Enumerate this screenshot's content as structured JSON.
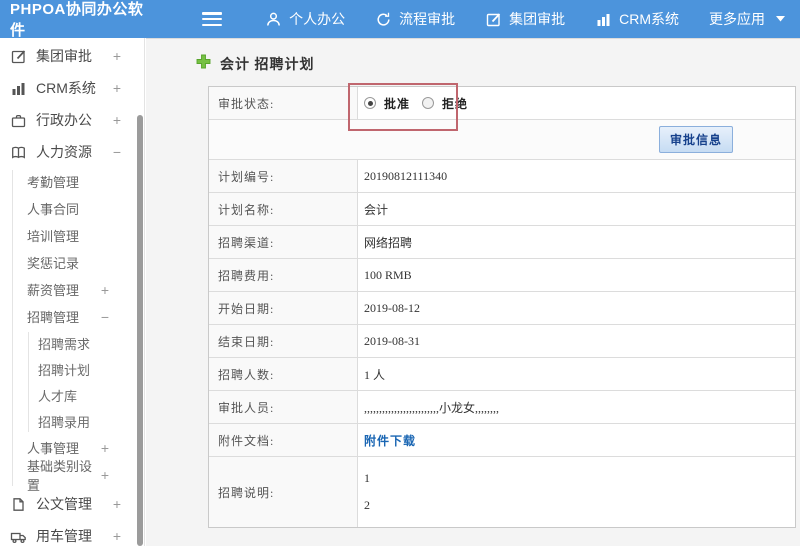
{
  "topbar": {
    "brand": "PHPOA协同办公软件",
    "menu": [
      {
        "label": "个人办公",
        "icon": "person-icon"
      },
      {
        "label": "流程审批",
        "icon": "flow-icon"
      },
      {
        "label": "集团审批",
        "icon": "edit-icon"
      },
      {
        "label": "CRM系统",
        "icon": "bar-chart-icon"
      },
      {
        "label": "更多应用",
        "icon": "caret-down-icon"
      }
    ]
  },
  "sidebar": {
    "items": [
      {
        "label": "集团审批",
        "icon": "edit-square-icon",
        "toggle": "+"
      },
      {
        "label": "CRM系统",
        "icon": "bar-chart-icon",
        "toggle": "+"
      },
      {
        "label": "行政办公",
        "icon": "briefcase-icon",
        "toggle": "+"
      },
      {
        "label": "人力资源",
        "icon": "book-icon",
        "toggle": "−"
      },
      {
        "label": "考勤管理"
      },
      {
        "label": "人事合同"
      },
      {
        "label": "培训管理"
      },
      {
        "label": "奖惩记录"
      },
      {
        "label": "薪资管理",
        "toggle": "+"
      },
      {
        "label": "招聘管理",
        "toggle": "−"
      },
      {
        "label": "招聘需求"
      },
      {
        "label": "招聘计划"
      },
      {
        "label": "人才库"
      },
      {
        "label": "招聘录用"
      },
      {
        "label": "人事管理",
        "toggle": "+"
      },
      {
        "label": "基础类别设置",
        "toggle": "+"
      },
      {
        "label": "公文管理",
        "icon": "document-icon",
        "toggle": "+"
      },
      {
        "label": "用车管理",
        "icon": "truck-icon",
        "toggle": "+"
      }
    ]
  },
  "main": {
    "title": "会计 招聘计划",
    "approval": {
      "label": "审批状态:",
      "options": [
        {
          "label": "批准",
          "checked": true
        },
        {
          "label": "拒绝",
          "checked": false
        }
      ]
    },
    "approve_button_label": "审批信息",
    "rows": [
      {
        "label": "计划编号:",
        "value": "20190812111340"
      },
      {
        "label": "计划名称:",
        "value": "会计"
      },
      {
        "label": "招聘渠道:",
        "value": "网络招聘"
      },
      {
        "label": "招聘费用:",
        "value": "100 RMB"
      },
      {
        "label": "开始日期:",
        "value": "2019-08-12"
      },
      {
        "label": "结束日期:",
        "value": "2019-08-31"
      },
      {
        "label": "招聘人数:",
        "value": "1 人"
      },
      {
        "label": "审批人员:",
        "value": ",,,,,,,,,,,,,,,,,,,,,,,,,小龙女,,,,,,,,"
      },
      {
        "label": "附件文档:",
        "value": "附件下载"
      },
      {
        "label": "招聘说明:",
        "value_lines": [
          "1",
          "2"
        ]
      }
    ]
  },
  "colors": {
    "topbar_blue": "#4c94dc",
    "link_blue": "#1a66b3",
    "button_text_blue": "#16418c",
    "button_bg_blue": "#c6dcf3",
    "annotation_red": "#c0666e",
    "plus_green": "#76c043"
  }
}
